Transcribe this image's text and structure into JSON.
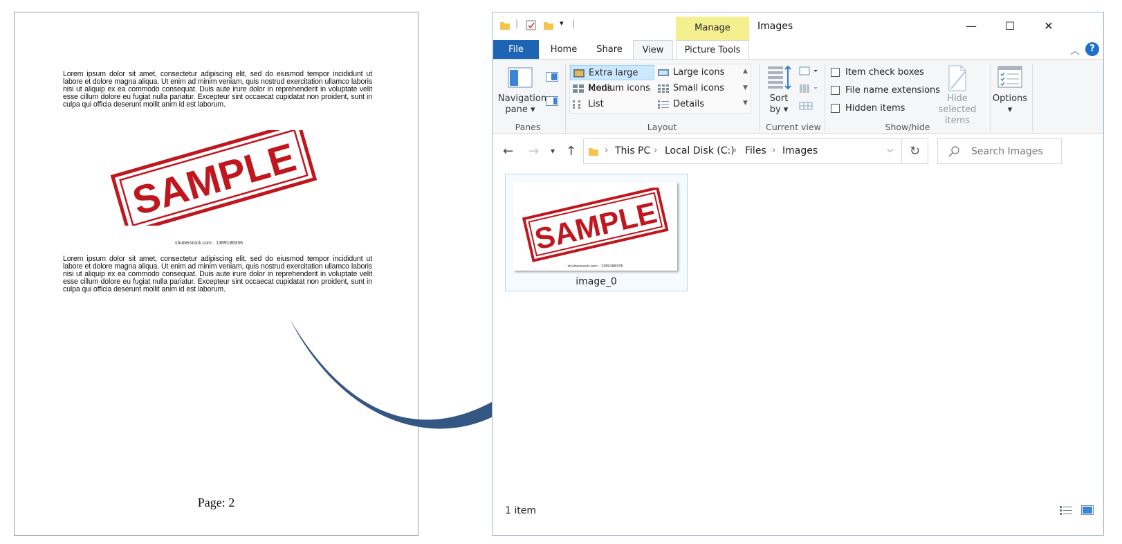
{
  "document": {
    "paragraph1": "Lorem ipsum dolor sit amet, consectetur adipiscing elit, sed do eiusmod tempor incididunt ut labore et dolore magna aliqua. Ut enim ad minim veniam, quis nostrud exercitation ullamco laboris nisi ut aliquip ex ea commodo consequat. Duis aute irure dolor in reprehenderit in voluptate velit esse cillum dolore eu fugiat nulla pariatur. Excepteur sint occaecat cupidatat non proident, sunt in culpa qui officia deserunt mollit anim id est laborum.",
    "stamp_text": "SAMPLE",
    "image_credit": "shutterstock.com · 1389188336",
    "paragraph2": "Lorem ipsum dolor sit amet, consectetur adipiscing elit, sed do eiusmod tempor incididunt ut labore et dolore magna aliqua. Ut enim ad minim veniam, quis nostrud exercitation ullamco laboris nisi ut aliquip ex ea commodo consequat. Duis aute irure dolor in reprehenderit in voluptate velit esse cillum dolore eu fugiat nulla pariatur. Excepteur sint occaecat cupidatat non proident, sunt in culpa qui officia deserunt mollit anim id est laborum.",
    "page_label": "Page: 2"
  },
  "explorer": {
    "title": "Images",
    "context_tab": "Manage",
    "tabs": {
      "file": "File",
      "home": "Home",
      "share": "Share",
      "view": "View",
      "picture_tools": "Picture Tools"
    },
    "ribbon": {
      "panes": {
        "navigation_pane_line1": "Navigation",
        "navigation_pane_line2": "pane",
        "group_label": "Panes"
      },
      "layout": {
        "items": [
          "Extra large icons",
          "Large icons",
          "Medium icons",
          "Small icons",
          "List",
          "Details"
        ],
        "selected": "Extra large icons",
        "group_label": "Layout"
      },
      "current_view": {
        "sort_line1": "Sort",
        "sort_line2": "by",
        "group_label": "Current view"
      },
      "show_hide": {
        "item_check_boxes": "Item check boxes",
        "file_name_extensions": "File name extensions",
        "hidden_items": "Hidden items",
        "hide_selected_line1": "Hide selected",
        "hide_selected_line2": "items",
        "group_label": "Show/hide"
      },
      "options": {
        "label": "Options"
      }
    },
    "address": {
      "crumbs": [
        "This PC",
        "Local Disk (C:)",
        "Files",
        "Images"
      ],
      "search_placeholder": "Search Images"
    },
    "files": [
      {
        "name": "image_0",
        "stamp_text": "SAMPLE",
        "credit": "shutterstock.com · 1389188336"
      }
    ],
    "status": {
      "item_count": "1 item"
    },
    "colors": {
      "file_tab": "#1e64b4",
      "manage_tab": "#f4ef8f",
      "selection": "#cce8ff",
      "stamp_red": "#c0161e"
    }
  },
  "arrow": {
    "color": "#345683",
    "icon": "curved-arrow"
  }
}
